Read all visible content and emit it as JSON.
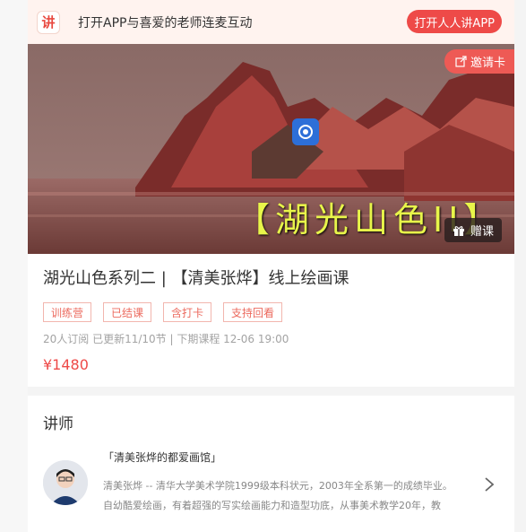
{
  "banner": {
    "logo_char": "讲",
    "text": "打开APP与喜爱的老师连麦互动",
    "open_button": "打开人人讲APP"
  },
  "hero": {
    "invite_label": "邀请卡",
    "gift_label": "赠课",
    "caption": "【湖光山色II】"
  },
  "course": {
    "title": "湖光山色系列二 | 【清美张烨】线上绘画课",
    "tags": [
      "训练营",
      "已结课",
      "含打卡",
      "支持回看"
    ],
    "stats": "20人订阅   已更新11/10节 | 下期课程 12-06 19:00",
    "price": "¥1480"
  },
  "teacher": {
    "section_title": "讲师",
    "name": "「清美张烨的都爱画馆」",
    "desc_line1": "清美张烨 -- 清华大学美术学院1999级本科状元，2003年全系第一的成绩毕业。",
    "desc_line2": "自幼酷爱绘画，有着超强的写实绘画能力和造型功底，从事美术教学20年，教"
  },
  "colors": {
    "accent": "#ee4a48",
    "tag_border": "#f2b6ae",
    "banner_bg": "#fff3ef",
    "caption": "#e8f54a"
  }
}
